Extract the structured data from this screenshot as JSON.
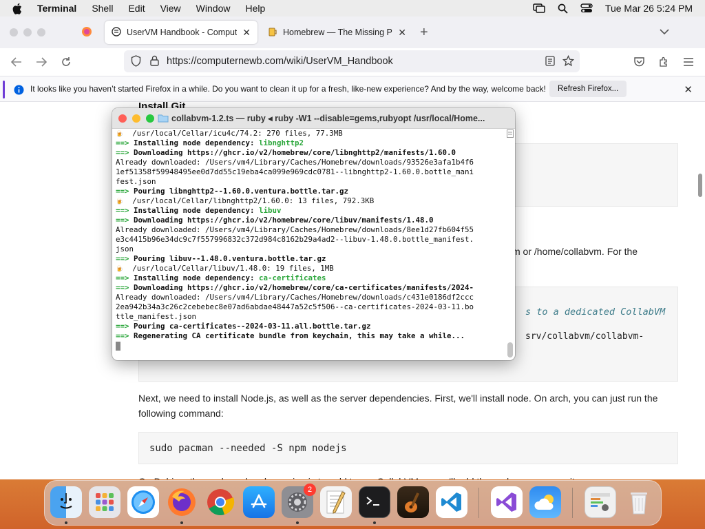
{
  "menubar": {
    "app_name": "Terminal",
    "menus": [
      "Shell",
      "Edit",
      "View",
      "Window",
      "Help"
    ],
    "clock": "Tue Mar 26  5:24 PM"
  },
  "browser": {
    "tabs": [
      {
        "label": "UserVM Handbook - Computer",
        "active": true
      },
      {
        "label": "Homebrew — The Missing Pack",
        "active": false
      }
    ],
    "url": "https://computernewb.com/wiki/UserVM_Handbook",
    "notification": {
      "text": "It looks like you haven’t started Firefox in a while. Do you want to clean it up for a fresh, like-new experience? And by the way, welcome back!",
      "button": "Refresh Firefox..."
    },
    "accent_color": "#6e3bd6"
  },
  "page": {
    "heading_fragment": "Install Git",
    "para_fragment_1": "vm or /home/collabvm. For the",
    "code_comment_fragment": "s to a dedicated CollabVM",
    "code_path_fragment": "srv/collabvm/collabvm-",
    "para_node": "Next, we need to install Node.js, as well as the server dependencies. First, we'll install node. On arch, you can just run the",
    "para_node_2": "following command:",
    "code_pacman": "sudo pacman --needed -S npm nodejs",
    "para_debian": "On Debian, the packaged node version is too old to run CollabVM, so we'll add the nodesource repository."
  },
  "terminal": {
    "title": "collabvm-1.2.ts — ruby ◂ ruby -W1 --disable=gems,rubyopt /usr/local/Home...",
    "lines": [
      {
        "kind": "beer",
        "text": "/usr/local/Cellar/icu4c/74.2: 270 files, 77.3MB"
      },
      {
        "kind": "dep",
        "prefix": "Installing node dependency: ",
        "name": "libnghttp2"
      },
      {
        "kind": "arrow",
        "text": "Downloading https://ghcr.io/v2/homebrew/core/libnghttp2/manifests/1.60.0"
      },
      {
        "kind": "plain",
        "text": "Already downloaded: /Users/vm4/Library/Caches/Homebrew/downloads/93526e3afa1b4f6"
      },
      {
        "kind": "plain",
        "text": "1ef51358f59948495ee0d7dd55c19eba4ca099e969cdc0781--libnghttp2-1.60.0.bottle_mani"
      },
      {
        "kind": "plain",
        "text": "fest.json"
      },
      {
        "kind": "arrow",
        "text": "Pouring libnghttp2--1.60.0.ventura.bottle.tar.gz"
      },
      {
        "kind": "beer",
        "text": "/usr/local/Cellar/libnghttp2/1.60.0: 13 files, 792.3KB"
      },
      {
        "kind": "dep",
        "prefix": "Installing node dependency: ",
        "name": "libuv"
      },
      {
        "kind": "arrow",
        "text": "Downloading https://ghcr.io/v2/homebrew/core/libuv/manifests/1.48.0"
      },
      {
        "kind": "plain",
        "text": "Already downloaded: /Users/vm4/Library/Caches/Homebrew/downloads/8ee1d27fb604f55"
      },
      {
        "kind": "plain",
        "text": "e3c4415b96e34dc9c7f557996832c372d984c8162b29a4ad2--libuv-1.48.0.bottle_manifest."
      },
      {
        "kind": "plain",
        "text": "json"
      },
      {
        "kind": "arrow",
        "text": "Pouring libuv--1.48.0.ventura.bottle.tar.gz"
      },
      {
        "kind": "beer",
        "text": "/usr/local/Cellar/libuv/1.48.0: 19 files, 1MB"
      },
      {
        "kind": "dep",
        "prefix": "Installing node dependency: ",
        "name": "ca-certificates"
      },
      {
        "kind": "arrow",
        "text": "Downloading https://ghcr.io/v2/homebrew/core/ca-certificates/manifests/2024-"
      },
      {
        "kind": "plain",
        "text": "Already downloaded: /Users/vm4/Library/Caches/Homebrew/downloads/c431e0186df2ccc"
      },
      {
        "kind": "plain",
        "text": "2ea942b34a3c26c2cebebec8e07ad6abdae48447a52c5f506--ca-certificates-2024-03-11.bo"
      },
      {
        "kind": "plain",
        "text": "ttle_manifest.json"
      },
      {
        "kind": "arrow",
        "text": "Pouring ca-certificates--2024-03-11.all.bottle.tar.gz"
      },
      {
        "kind": "arrow",
        "text": "Regenerating CA certificate bundle from keychain, this may take a while..."
      }
    ],
    "arrow_symbol": "==>",
    "beer_symbol": "🍺"
  },
  "dock": {
    "apps": [
      "finder-icon",
      "launchpad-icon",
      "safari-icon",
      "firefox-icon",
      "chrome-icon",
      "app-store-icon",
      "system-settings-icon",
      "textedit-icon",
      "terminal-icon",
      "garageband-icon",
      "vscode-icon",
      "visual-studio-icon",
      "weather-icon",
      "activity-icon",
      "trash-icon"
    ],
    "settings_badge": "2"
  }
}
